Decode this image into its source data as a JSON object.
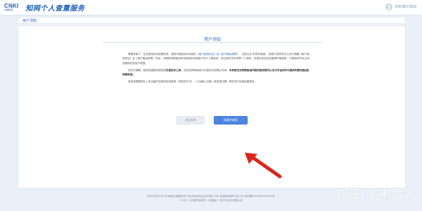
{
  "header": {
    "logo_text": "CNKI",
    "logo_sub": "中国知网",
    "title": "知网个人查重服务",
    "phone": "15678671316"
  },
  "breadcrumb": {
    "label": "用户须知"
  },
  "notice": {
    "title": "用户须知",
    "p1_a": "尊敬的用户，在您使用本系统服务前，请您仔细阅读本系统的",
    "p1_link1": "《用户使用协议》",
    "p1_b": "及",
    "p1_link2": "《用户隐私政策》",
    "p1_c": "，当您点击\"同意并继续\"，即表示您同意并已充分理解《用户使用协议》及《用户隐私政策》内容。中国知网是面向所有使用本系统用户的个人隐私权，您注册的手机号等个人资料、您提交的检测文献等严格保密，中国知网不会主动泄露和出售用户数据。",
    "p2_a": "您充分理解、知网查重服务提供的",
    "p2_bold1": "仅是技术工具",
    "p2_b": "，您的选择和使用行为使现为您确认可用，",
    "p2_bold2": "本系统无法判断检测内容的版权情况以及文件由你作为最终判断依据(或)判断标准。",
    "p3": "系统将根据您在上传文献时选择的检测类型（或检测方式），以对截止日期（或发表日期）等在进行检测结果报告。"
  },
  "buttons": {
    "decline": "退出系统",
    "agree": "同意并继续"
  },
  "footer": {
    "line1": "京ICP证040431号 网络出版服务许可证(总)网出证(京)字第271号 出版物经营许可证 京公网安备11010802020460号",
    "line2": "© 2022 《中国学术期刊（光盘版）》电子杂志社有限公司"
  },
  "watermark": "知乎 @未命名",
  "colors": {
    "accent": "#2f6bc2",
    "agree_button": "#4c86e0",
    "annotation": "#d9261c"
  }
}
